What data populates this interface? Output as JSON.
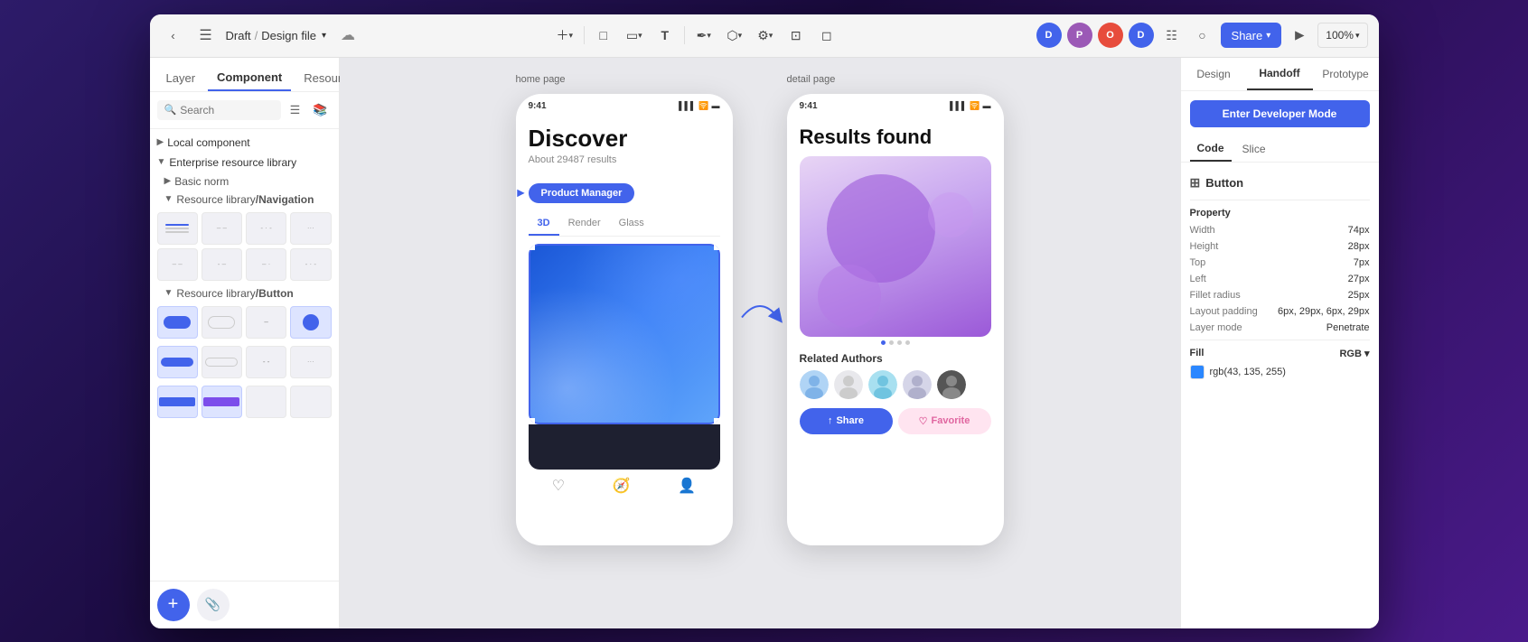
{
  "window": {
    "title": "Design file"
  },
  "topbar": {
    "breadcrumb_draft": "Draft",
    "breadcrumb_sep": "/",
    "breadcrumb_file": "Design file",
    "share_label": "Share",
    "zoom_label": "100%",
    "avatars": [
      {
        "initials": "D",
        "color": "#4263eb"
      },
      {
        "initials": "P",
        "color": "#9b59b6"
      },
      {
        "initials": "O",
        "color": "#e74c3c"
      },
      {
        "initials": "D",
        "color": "#4263eb"
      }
    ]
  },
  "sidebar": {
    "tabs": [
      "Layer",
      "Component",
      "Resource"
    ],
    "active_tab": "Component",
    "search_placeholder": "Search",
    "sections": [
      {
        "label": "Local component",
        "expanded": false
      },
      {
        "label": "Enterprise resource library",
        "expanded": true,
        "subsections": [
          {
            "label": "Basic norm",
            "expanded": false
          },
          {
            "label": "Resource library/Navigation",
            "expanded": true
          },
          {
            "label": "Resource library/Button",
            "expanded": true
          }
        ]
      }
    ]
  },
  "canvas": {
    "page1_label": "home page",
    "page2_label": "detail page",
    "status_time": "9:41",
    "status_time2": "9:41",
    "discover_title": "Discover",
    "discover_sub": "About 29487 results",
    "product_badge": "Product Manager",
    "tabs_3d": "3D",
    "tabs_render": "Render",
    "tabs_glass": "Glass",
    "results_title": "Results found",
    "related_authors": "Related Authors"
  },
  "right_panel": {
    "tabs": [
      "Design",
      "Handoff",
      "Prototype"
    ],
    "active_tab": "Handoff",
    "dev_mode_btn": "Enter Developer Mode",
    "sub_tabs": [
      "Code",
      "Slice"
    ],
    "active_sub_tab": "Code",
    "component_name": "Button",
    "property_section": "Property",
    "properties": [
      {
        "label": "Width",
        "value": "74px"
      },
      {
        "label": "Height",
        "value": "28px"
      },
      {
        "label": "Top",
        "value": "7px"
      },
      {
        "label": "Left",
        "value": "27px"
      },
      {
        "label": "Fillet radius",
        "value": "25px"
      },
      {
        "label": "Layout padding",
        "value": "6px, 29px, 6px, 29px"
      },
      {
        "label": "Layer mode",
        "value": "Penetrate"
      }
    ],
    "fill_label": "Fill",
    "fill_mode": "RGB",
    "fill_color_hex": "rgb(43, 135, 255)",
    "fill_color_swatch": "#2b87ff"
  }
}
